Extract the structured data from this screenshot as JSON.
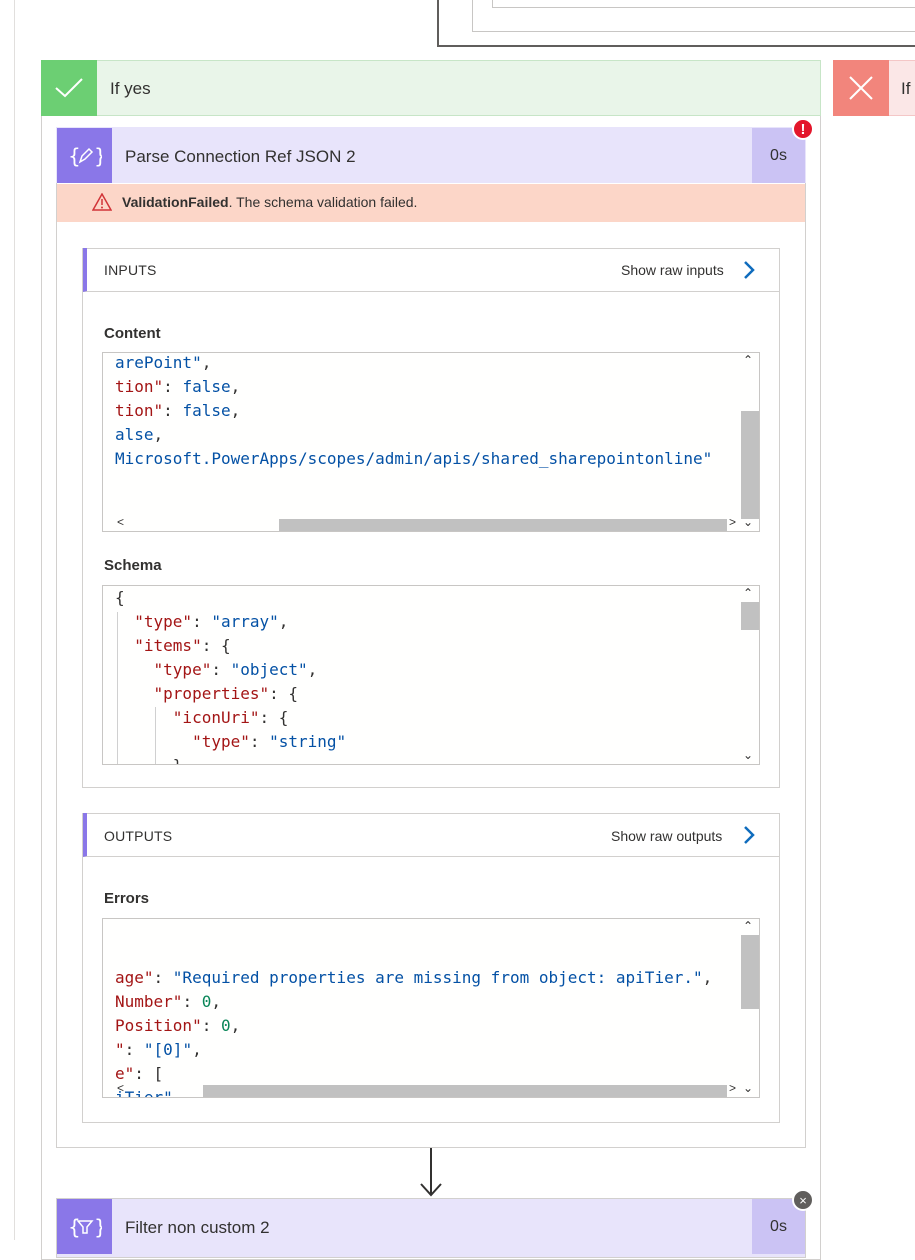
{
  "branches": {
    "yes_label": "If yes",
    "no_label": "If"
  },
  "action": {
    "title": "Parse Connection Ref JSON 2",
    "duration": "0s",
    "error_badge": "!",
    "error_code": "ValidationFailed",
    "error_message": ". The schema validation failed."
  },
  "inputs": {
    "section_title": "INPUTS",
    "raw_link": "Show raw inputs",
    "content_label": "Content",
    "content_lines": [
      [
        {
          "t": "s",
          "v": "arePoint\""
        },
        {
          "t": "p",
          "v": ","
        }
      ],
      [
        {
          "t": "k",
          "v": "tion\""
        },
        {
          "t": "p",
          "v": ": "
        },
        {
          "t": "s",
          "v": "false"
        },
        {
          "t": "p",
          "v": ","
        }
      ],
      [
        {
          "t": "k",
          "v": "tion\""
        },
        {
          "t": "p",
          "v": ": "
        },
        {
          "t": "s",
          "v": "false"
        },
        {
          "t": "p",
          "v": ","
        }
      ],
      [
        {
          "t": "s",
          "v": "alse"
        },
        {
          "t": "p",
          "v": ","
        }
      ],
      [
        {
          "t": "s",
          "v": "Microsoft.PowerApps/scopes/admin/apis/shared_sharepointonline\""
        }
      ]
    ],
    "schema_label": "Schema",
    "schema_lines": [
      [
        {
          "t": "p",
          "v": "{"
        }
      ],
      [
        {
          "t": "k",
          "v": "  \"type\""
        },
        {
          "t": "p",
          "v": ": "
        },
        {
          "t": "s",
          "v": "\"array\""
        },
        {
          "t": "p",
          "v": ","
        }
      ],
      [
        {
          "t": "k",
          "v": "  \"items\""
        },
        {
          "t": "p",
          "v": ": {"
        }
      ],
      [
        {
          "t": "k",
          "v": "    \"type\""
        },
        {
          "t": "p",
          "v": ": "
        },
        {
          "t": "s",
          "v": "\"object\""
        },
        {
          "t": "p",
          "v": ","
        }
      ],
      [
        {
          "t": "k",
          "v": "    \"properties\""
        },
        {
          "t": "p",
          "v": ": {"
        }
      ],
      [
        {
          "t": "k",
          "v": "      \"iconUri\""
        },
        {
          "t": "p",
          "v": ": {"
        }
      ],
      [
        {
          "t": "k",
          "v": "        \"type\""
        },
        {
          "t": "p",
          "v": ": "
        },
        {
          "t": "s",
          "v": "\"string\""
        }
      ],
      [
        {
          "t": "p",
          "v": "      },"
        }
      ]
    ]
  },
  "outputs": {
    "section_title": "OUTPUTS",
    "raw_link": "Show raw outputs",
    "errors_label": "Errors",
    "errors_lines": [
      [
        {
          "t": "k",
          "v": "age\""
        },
        {
          "t": "p",
          "v": ": "
        },
        {
          "t": "s",
          "v": "\"Required properties are missing from object: apiTier.\""
        },
        {
          "t": "p",
          "v": ","
        }
      ],
      [
        {
          "t": "k",
          "v": "Number\""
        },
        {
          "t": "p",
          "v": ": "
        },
        {
          "t": "n",
          "v": "0"
        },
        {
          "t": "p",
          "v": ","
        }
      ],
      [
        {
          "t": "k",
          "v": "Position\""
        },
        {
          "t": "p",
          "v": ": "
        },
        {
          "t": "n",
          "v": "0"
        },
        {
          "t": "p",
          "v": ","
        }
      ],
      [
        {
          "t": "k",
          "v": "\""
        },
        {
          "t": "p",
          "v": ": "
        },
        {
          "t": "s",
          "v": "\"[0]\""
        },
        {
          "t": "p",
          "v": ","
        }
      ],
      [
        {
          "t": "k",
          "v": "e\""
        },
        {
          "t": "p",
          "v": ": ["
        }
      ],
      [
        {
          "t": "s",
          "v": "iTier\""
        }
      ]
    ]
  },
  "next_action": {
    "title": "Filter non custom 2",
    "duration": "0s",
    "badge": "×"
  },
  "icons": {
    "yes": "checkmark-icon",
    "no": "close-icon",
    "parse_json": "parse-json-icon",
    "filter": "filter-array-icon",
    "warning": "warning-icon",
    "chevron": "chevron-right-icon"
  },
  "colors": {
    "yes_accent": "#6ccf73",
    "no_accent": "#f2857c",
    "action_accent": "#8a77e8",
    "error_bar": "#fcd6c8",
    "link_chevron": "#0f6cbd"
  }
}
